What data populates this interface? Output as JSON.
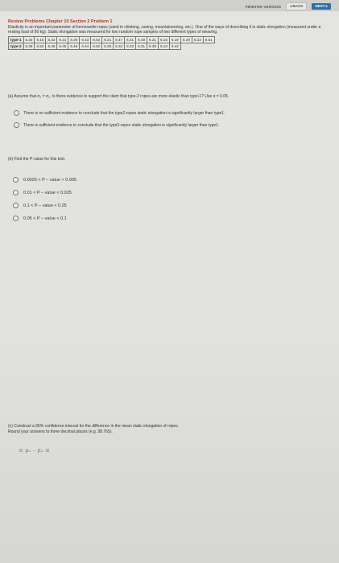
{
  "nav": {
    "printer_version": "PRINTER VERSION",
    "back": "◂ BACK",
    "next": "NEXT ▸"
  },
  "problem": {
    "title": "Review Problems Chapter 10 Section 2 Problem 1",
    "intro_1": "Elasticity is an important parameter of kernmantle ropes (used in climbing, caving, mountaineering, etc.). One of the ways of describing it is static elongation (measured under a resting load of 80 kg). Static elongation was measured for two random rope samples of two different types of weaving.",
    "table": [
      {
        "label": "type-1",
        "values": [
          "6.34",
          "6.16",
          "6.32",
          "6.21",
          "6.36",
          "6.43",
          "6.02",
          "6.21",
          "6.47",
          "6.21",
          "6.49",
          "6.21",
          "6.16",
          "6.19",
          "6.29",
          "6.33",
          "6.51"
        ]
      },
      {
        "label": "type-2",
        "values": [
          "6.38",
          "6.52",
          "6.49",
          "6.45",
          "6.46",
          "6.44",
          "6.52",
          "6.33",
          "6.33",
          "6.33",
          "6.31",
          "6.39",
          "6.13",
          "6.42"
        ]
      }
    ]
  },
  "part_a": {
    "question": "(a) Assume that σ₁ = σ₂. Is there evidence to support the claim that type-2 ropes are more elastic than type-1? Use α = 0.05.",
    "options": [
      "There is no sufficient evidence to conclude that the type2-ropes static elongation is significantly larger than type1.",
      "There is sufficient evidence to conclude that the type2-ropes static elongation is significantly larger than type1."
    ]
  },
  "part_b": {
    "question": "(b) Find the P-value for this test.",
    "options": [
      "0.0025 < P – value < 0.005",
      "0.01 < P – value < 0.025",
      "0.1 < P – value < 0.25",
      "0.05 < P – value < 0.1"
    ]
  },
  "part_c": {
    "question": "(c) Construct a 95% confidence interval for the difference in the mean static elongation of ropes.",
    "instruction": "Round your answers to three decimal places (e.g. 98.765).",
    "answer_expr": "≤ μ₁ – μ₂ ≤"
  }
}
